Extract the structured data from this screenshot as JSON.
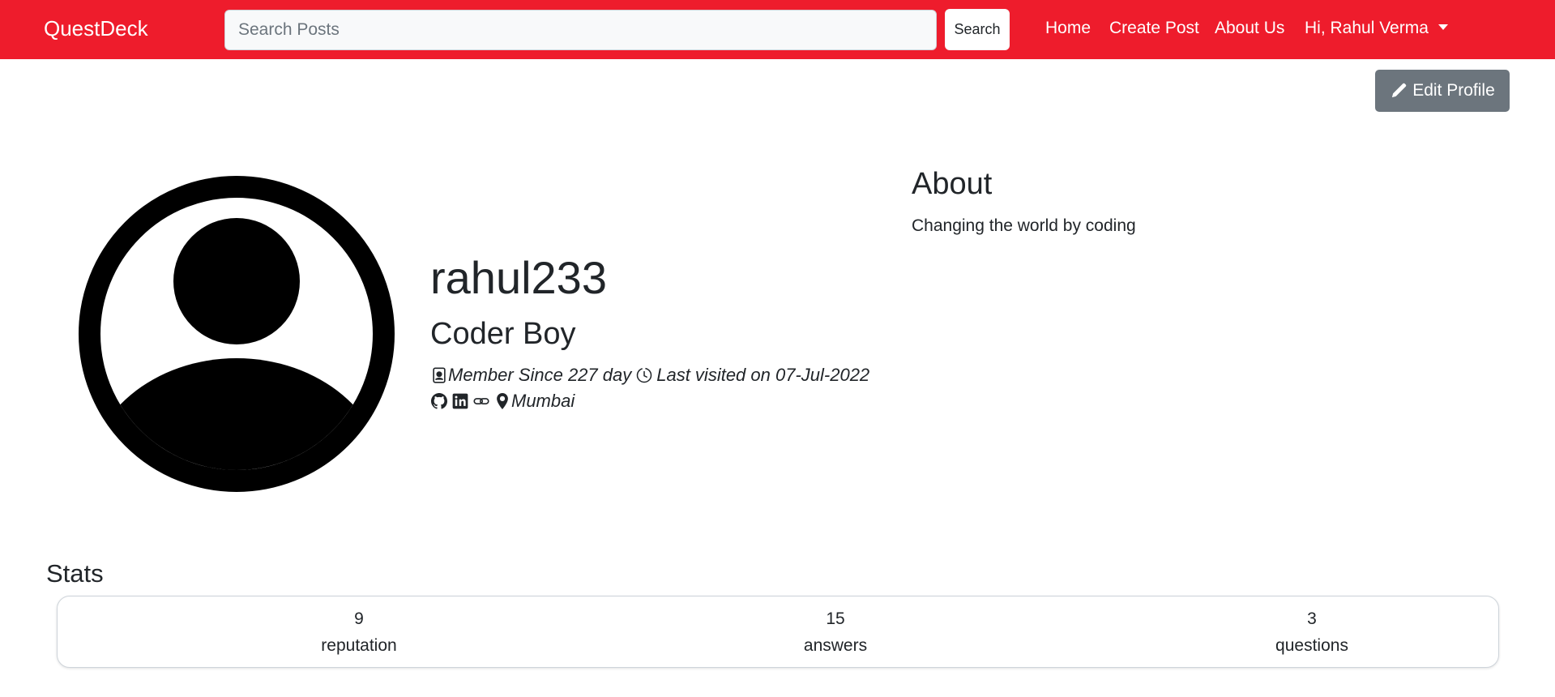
{
  "navbar": {
    "brand": "QuestDeck",
    "search_placeholder": "Search Posts",
    "search_button": "Search",
    "links": {
      "home": "Home",
      "create_post": "Create Post",
      "about_us": "About Us",
      "user_menu": "Hi, Rahul Verma"
    },
    "background_color": "#ee1c2c"
  },
  "edit_profile": {
    "label": "Edit Profile",
    "icon": "pencil-icon"
  },
  "profile": {
    "username": "rahul233",
    "title": "Coder Boy",
    "member_since": "Member Since 227 day",
    "last_visited": "Last visited on 07-Jul-2022",
    "location": "Mumbai",
    "icons": [
      "person-badge-icon",
      "clock-icon",
      "github-icon",
      "linkedin-icon",
      "link-icon",
      "location-pin-icon"
    ]
  },
  "about": {
    "heading": "About",
    "text": "Changing the world by coding"
  },
  "stats": {
    "heading": "Stats",
    "items": [
      {
        "value": "9",
        "label": "reputation"
      },
      {
        "value": "15",
        "label": "answers"
      },
      {
        "value": "3",
        "label": "questions"
      }
    ]
  }
}
